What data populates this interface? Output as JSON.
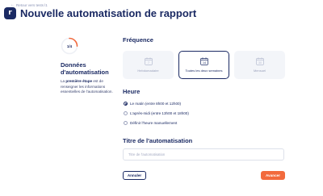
{
  "header": {
    "back_label": "Retour vers tests l1",
    "logo_letter": "r",
    "title": "Nouvelle automatisation de rapport"
  },
  "step": {
    "progress_label": "1/4",
    "progress_fraction": 0.25,
    "title": "Données d'automatisation",
    "desc_prefix": "La ",
    "desc_bold": "première étape",
    "desc_rest": " est de renseigner les informations essentielles de l'automatisation."
  },
  "frequency": {
    "title": "Fréquence",
    "options": [
      {
        "label": "Hebdomadaire",
        "icon": "calendar-icon",
        "day": "7",
        "selected": false
      },
      {
        "label": "Toutes les deux semaines",
        "icon": "calendar-icon",
        "day": "14",
        "selected": true
      },
      {
        "label": "Mensuel",
        "icon": "calendar-icon",
        "day": "30",
        "selected": false
      }
    ]
  },
  "hour": {
    "title": "Heure",
    "options": [
      {
        "label": "Le matin (entre 8h00 et 12h00)",
        "checked": true
      },
      {
        "label": "L'après-midi (entre 13h00 et 18h00)",
        "checked": false
      },
      {
        "label": "Définir l'heure manuellement",
        "checked": false
      }
    ]
  },
  "automation_title": {
    "title": "Titre de l'automatisation",
    "placeholder": "Titre de l'automatisation",
    "value": ""
  },
  "buttons": {
    "cancel": "Annuler",
    "next": "Avancer"
  },
  "colors": {
    "brand_navy": "#1b2a63",
    "accent_orange": "#f26a3d",
    "progress_ring": "#f26a3d",
    "card_bg": "#f3f5f9"
  }
}
